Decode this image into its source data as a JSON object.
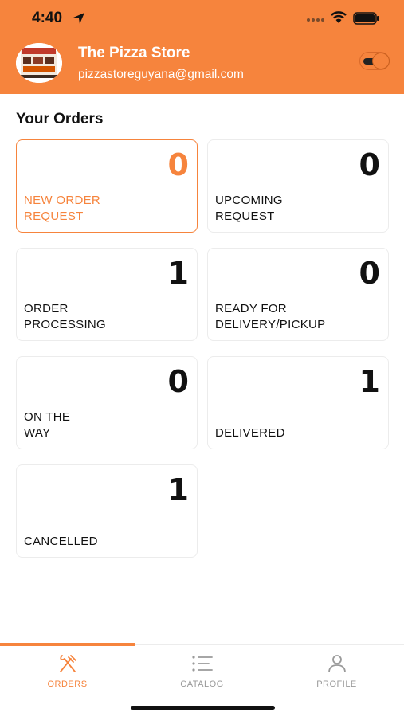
{
  "status_bar": {
    "time": "4:40"
  },
  "store": {
    "name": "The Pizza Store",
    "email": "pizzastoreguyana@gmail.com",
    "logo_text": "PIZZAS"
  },
  "orders": {
    "title": "Your Orders",
    "cards": [
      {
        "label": "NEW ORDER\nREQUEST",
        "count": "0"
      },
      {
        "label": "UPCOMING\nREQUEST",
        "count": "0"
      },
      {
        "label": "ORDER\nPROCESSING",
        "count": "1"
      },
      {
        "label": "READY FOR\nDELIVERY/PICKUP",
        "count": "0"
      },
      {
        "label": "ON THE\nWAY",
        "count": "0"
      },
      {
        "label": "DELIVERED",
        "count": "1"
      },
      {
        "label": "CANCELLED",
        "count": "1"
      }
    ]
  },
  "tabs": [
    {
      "label": "ORDERS",
      "icon": "fork-knife-icon"
    },
    {
      "label": "CATALOG",
      "icon": "list-icon"
    },
    {
      "label": "PROFILE",
      "icon": "person-icon"
    }
  ],
  "colors": {
    "accent": "#F6843D",
    "text": "#111111",
    "inactive": "#9A9A9A"
  }
}
